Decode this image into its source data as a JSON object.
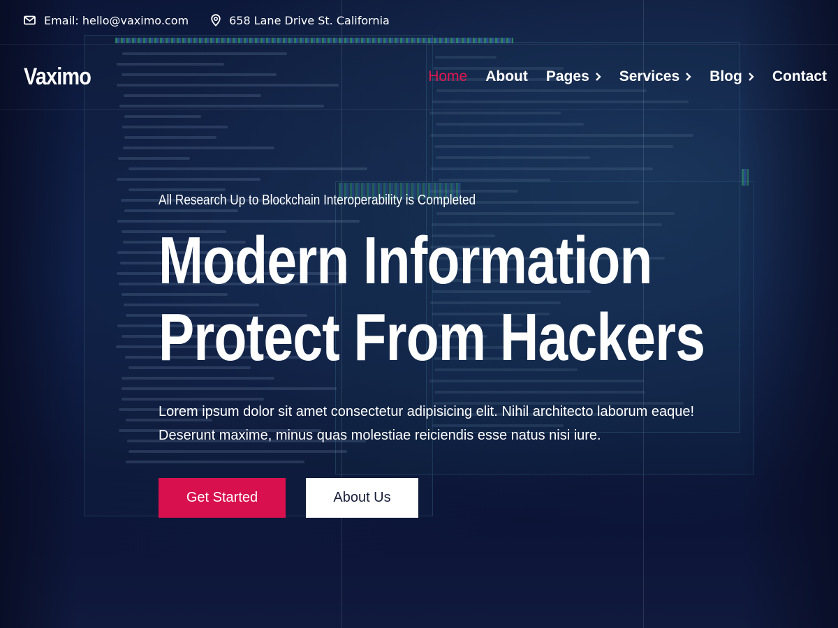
{
  "topbar": {
    "email_text": "Email: hello@vaximo.com",
    "address_text": "658 Lane Drive St. California"
  },
  "brand": {
    "logo_text": "Vaximo"
  },
  "nav": {
    "items": [
      {
        "label": "Home",
        "active": true,
        "has_dropdown": false
      },
      {
        "label": "About",
        "active": false,
        "has_dropdown": false
      },
      {
        "label": "Pages",
        "active": false,
        "has_dropdown": true
      },
      {
        "label": "Services",
        "active": false,
        "has_dropdown": true
      },
      {
        "label": "Blog",
        "active": false,
        "has_dropdown": true
      },
      {
        "label": "Contact",
        "active": false,
        "has_dropdown": false
      }
    ]
  },
  "hero": {
    "eyebrow": "All Research Up to Blockchain Interoperability is Completed",
    "title_line1": "Modern Information",
    "title_line2": "Protect From Hackers",
    "description_line1": "Lorem ipsum dolor sit amet consectetur adipisicing elit. Nihil architecto laborum eaque!",
    "description_line2": "Deserunt maxime, minus quas molestiae reiciendis esse natus nisi iure.",
    "primary_button": "Get Started",
    "secondary_button": "About Us"
  },
  "colors": {
    "accent": "#d8104e",
    "active_nav": "#e0174f",
    "background": "#0a1230",
    "text": "#ffffff"
  },
  "icons": {
    "email": "mail-icon",
    "address": "map-pin-icon",
    "dropdown": "chevron-right-icon"
  }
}
